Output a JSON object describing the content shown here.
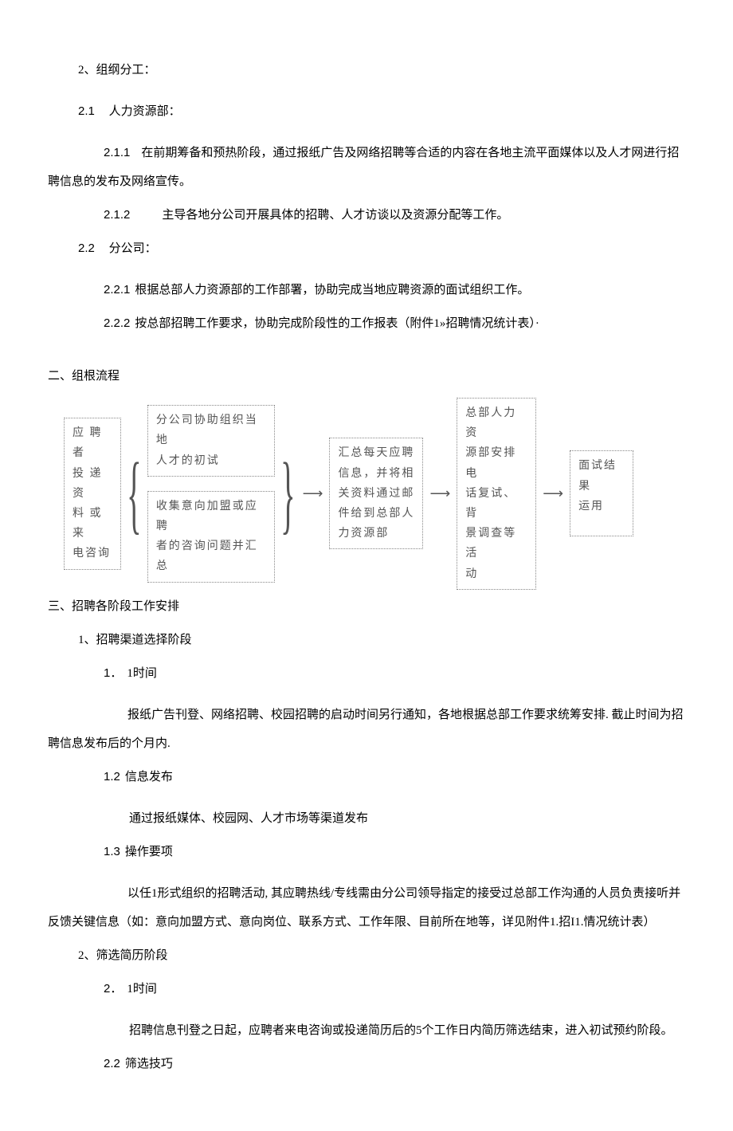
{
  "s2": {
    "title": "2、组纲分工：",
    "s21": {
      "title_num": "2.1",
      "title_txt": "人力资源部：",
      "p211_num": "2.1.1",
      "p211": "在前期筹备和预热阶段，通过报纸广告及网络招聘等合适的内容在各地主流平面媒体以及人才网进行招聘信息的发布及网络宣传。",
      "p212_num": "2.1.2",
      "p212": "主导各地分公司开展具体的招聘、人才访谈以及资源分配等工作。"
    },
    "s22": {
      "title_num": "2.2",
      "title_txt": "分公司：",
      "p221_num": "2.2.1",
      "p221": "根据总部人力资源部的工作部署，协助完成当地应聘资源的面试组织工作。",
      "p222_num": "2.2.2",
      "p222": "按总部招聘工作要求，协助完成阶段性的工作报表（附件1»招聘情况统计表）·"
    }
  },
  "flow": {
    "heading": "二、组根流程",
    "box1": "应 聘 者\n投 递 资\n料 或 来\n电咨询",
    "box2a": "分公司协助组织当地\n人才的初试",
    "box2b": "收集意向加盟或应聘\n者的咨询问题并汇总",
    "box3": "汇总每天应聘\n信息，并将相\n关资料通过邮\n件给到总部人\n力资源部",
    "box4": "总部人力资\n源部安排电\n话复试、背\n景调查等活\n动",
    "box5": "面试结果\n运用"
  },
  "s3": {
    "heading": "三、招聘各阶段工作安排",
    "p1": {
      "title": "1、招聘渠道选择阶段",
      "t11_num": "1．",
      "t11_txt": "1时间",
      "t11_body": "报纸广告刊登、网络招聘、校园招聘的启动时间另行通知，各地根据总部工作要求统筹安排. 截止时间为招聘信息发布后的个月内.",
      "t12_num": "1.2",
      "t12_txt": "信息发布",
      "t12_body": "通过报纸媒体、校园网、人才市场等渠道发布",
      "t13_num": "1.3",
      "t13_txt": "操作要项",
      "t13_body": "以任1形式组织的招聘活动, 其应聘热线/专线需由分公司领导指定的接受过总部工作沟通的人员负责接听并反馈关键信息（如：意向加盟方式、意向岗位、联系方式、工作年限、目前所在地等，详见附件1.招I1.情况统计表）"
    },
    "p2": {
      "title": "2、筛选简历阶段",
      "t21_num": "2．",
      "t21_txt": "1时间",
      "t21_body": "招聘信息刊登之日起，应聘者来电咨询或投递简历后的5个工作日内简历筛选结束，进入初试预约阶段。",
      "t22_num": "2.2",
      "t22_txt": "筛选技巧"
    }
  }
}
